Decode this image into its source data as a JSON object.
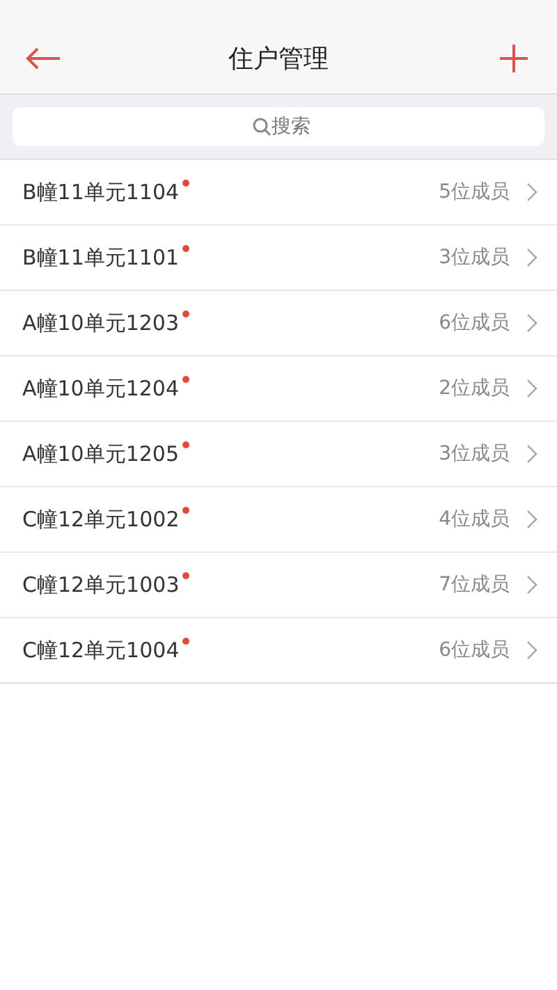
{
  "header": {
    "title": "住户管理"
  },
  "search": {
    "placeholder": "搜索"
  },
  "rows": [
    {
      "name": "B幢11单元1104",
      "unread": true,
      "members": "5位成员"
    },
    {
      "name": "B幢11单元1101",
      "unread": true,
      "members": "3位成员"
    },
    {
      "name": "A幢10单元1203",
      "unread": true,
      "members": "6位成员"
    },
    {
      "name": "A幢10单元1204",
      "unread": true,
      "members": "2位成员"
    },
    {
      "name": "A幢10单元1205",
      "unread": true,
      "members": "3位成员"
    },
    {
      "name": "C幢12单元1002",
      "unread": true,
      "members": "4位成员"
    },
    {
      "name": "C幢12单元1003",
      "unread": true,
      "members": "7位成员"
    },
    {
      "name": "C幢12单元1004",
      "unread": true,
      "members": "6位成员"
    }
  ]
}
